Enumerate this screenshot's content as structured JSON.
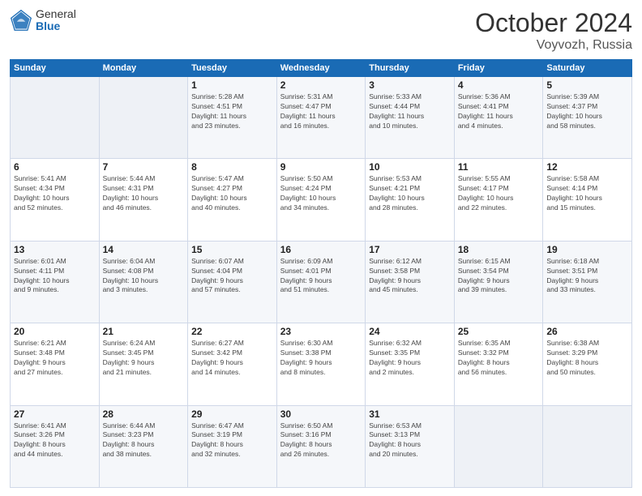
{
  "header": {
    "logo_general": "General",
    "logo_blue": "Blue",
    "month_title": "October 2024",
    "location": "Voyvozh, Russia"
  },
  "weekdays": [
    "Sunday",
    "Monday",
    "Tuesday",
    "Wednesday",
    "Thursday",
    "Friday",
    "Saturday"
  ],
  "weeks": [
    [
      {
        "day": "",
        "info": ""
      },
      {
        "day": "",
        "info": ""
      },
      {
        "day": "1",
        "info": "Sunrise: 5:28 AM\nSunset: 4:51 PM\nDaylight: 11 hours\nand 23 minutes."
      },
      {
        "day": "2",
        "info": "Sunrise: 5:31 AM\nSunset: 4:47 PM\nDaylight: 11 hours\nand 16 minutes."
      },
      {
        "day": "3",
        "info": "Sunrise: 5:33 AM\nSunset: 4:44 PM\nDaylight: 11 hours\nand 10 minutes."
      },
      {
        "day": "4",
        "info": "Sunrise: 5:36 AM\nSunset: 4:41 PM\nDaylight: 11 hours\nand 4 minutes."
      },
      {
        "day": "5",
        "info": "Sunrise: 5:39 AM\nSunset: 4:37 PM\nDaylight: 10 hours\nand 58 minutes."
      }
    ],
    [
      {
        "day": "6",
        "info": "Sunrise: 5:41 AM\nSunset: 4:34 PM\nDaylight: 10 hours\nand 52 minutes."
      },
      {
        "day": "7",
        "info": "Sunrise: 5:44 AM\nSunset: 4:31 PM\nDaylight: 10 hours\nand 46 minutes."
      },
      {
        "day": "8",
        "info": "Sunrise: 5:47 AM\nSunset: 4:27 PM\nDaylight: 10 hours\nand 40 minutes."
      },
      {
        "day": "9",
        "info": "Sunrise: 5:50 AM\nSunset: 4:24 PM\nDaylight: 10 hours\nand 34 minutes."
      },
      {
        "day": "10",
        "info": "Sunrise: 5:53 AM\nSunset: 4:21 PM\nDaylight: 10 hours\nand 28 minutes."
      },
      {
        "day": "11",
        "info": "Sunrise: 5:55 AM\nSunset: 4:17 PM\nDaylight: 10 hours\nand 22 minutes."
      },
      {
        "day": "12",
        "info": "Sunrise: 5:58 AM\nSunset: 4:14 PM\nDaylight: 10 hours\nand 15 minutes."
      }
    ],
    [
      {
        "day": "13",
        "info": "Sunrise: 6:01 AM\nSunset: 4:11 PM\nDaylight: 10 hours\nand 9 minutes."
      },
      {
        "day": "14",
        "info": "Sunrise: 6:04 AM\nSunset: 4:08 PM\nDaylight: 10 hours\nand 3 minutes."
      },
      {
        "day": "15",
        "info": "Sunrise: 6:07 AM\nSunset: 4:04 PM\nDaylight: 9 hours\nand 57 minutes."
      },
      {
        "day": "16",
        "info": "Sunrise: 6:09 AM\nSunset: 4:01 PM\nDaylight: 9 hours\nand 51 minutes."
      },
      {
        "day": "17",
        "info": "Sunrise: 6:12 AM\nSunset: 3:58 PM\nDaylight: 9 hours\nand 45 minutes."
      },
      {
        "day": "18",
        "info": "Sunrise: 6:15 AM\nSunset: 3:54 PM\nDaylight: 9 hours\nand 39 minutes."
      },
      {
        "day": "19",
        "info": "Sunrise: 6:18 AM\nSunset: 3:51 PM\nDaylight: 9 hours\nand 33 minutes."
      }
    ],
    [
      {
        "day": "20",
        "info": "Sunrise: 6:21 AM\nSunset: 3:48 PM\nDaylight: 9 hours\nand 27 minutes."
      },
      {
        "day": "21",
        "info": "Sunrise: 6:24 AM\nSunset: 3:45 PM\nDaylight: 9 hours\nand 21 minutes."
      },
      {
        "day": "22",
        "info": "Sunrise: 6:27 AM\nSunset: 3:42 PM\nDaylight: 9 hours\nand 14 minutes."
      },
      {
        "day": "23",
        "info": "Sunrise: 6:30 AM\nSunset: 3:38 PM\nDaylight: 9 hours\nand 8 minutes."
      },
      {
        "day": "24",
        "info": "Sunrise: 6:32 AM\nSunset: 3:35 PM\nDaylight: 9 hours\nand 2 minutes."
      },
      {
        "day": "25",
        "info": "Sunrise: 6:35 AM\nSunset: 3:32 PM\nDaylight: 8 hours\nand 56 minutes."
      },
      {
        "day": "26",
        "info": "Sunrise: 6:38 AM\nSunset: 3:29 PM\nDaylight: 8 hours\nand 50 minutes."
      }
    ],
    [
      {
        "day": "27",
        "info": "Sunrise: 6:41 AM\nSunset: 3:26 PM\nDaylight: 8 hours\nand 44 minutes."
      },
      {
        "day": "28",
        "info": "Sunrise: 6:44 AM\nSunset: 3:23 PM\nDaylight: 8 hours\nand 38 minutes."
      },
      {
        "day": "29",
        "info": "Sunrise: 6:47 AM\nSunset: 3:19 PM\nDaylight: 8 hours\nand 32 minutes."
      },
      {
        "day": "30",
        "info": "Sunrise: 6:50 AM\nSunset: 3:16 PM\nDaylight: 8 hours\nand 26 minutes."
      },
      {
        "day": "31",
        "info": "Sunrise: 6:53 AM\nSunset: 3:13 PM\nDaylight: 8 hours\nand 20 minutes."
      },
      {
        "day": "",
        "info": ""
      },
      {
        "day": "",
        "info": ""
      }
    ]
  ]
}
